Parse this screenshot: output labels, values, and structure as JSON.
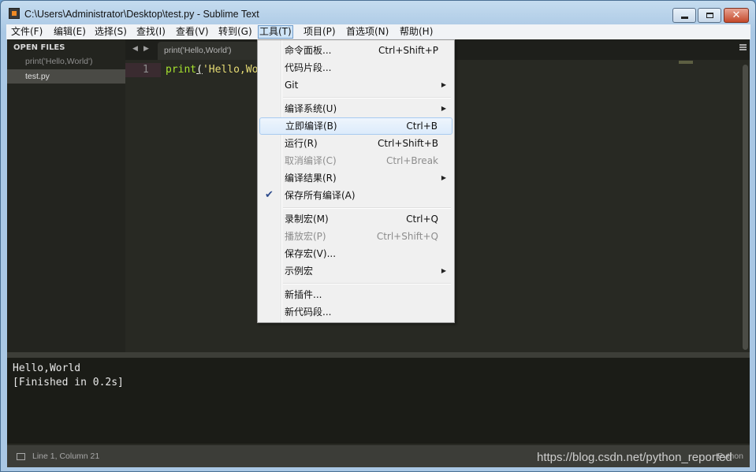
{
  "window": {
    "title": "C:\\Users\\Administrator\\Desktop\\test.py - Sublime Text",
    "icon": "sublime-text-icon",
    "controls": {
      "minimize": "_",
      "maximize": "□",
      "close": "✕"
    }
  },
  "menubar": {
    "items": [
      {
        "label": "文件(F)"
      },
      {
        "label": "编辑(E)"
      },
      {
        "label": "选择(S)"
      },
      {
        "label": "查找(I)"
      },
      {
        "label": "查看(V)"
      },
      {
        "label": "转到(G)"
      },
      {
        "label": "工具(T)",
        "active": true
      },
      {
        "label": "项目(P)"
      },
      {
        "label": "首选项(N)"
      },
      {
        "label": "帮助(H)"
      }
    ]
  },
  "sidebar": {
    "header": "OPEN FILES",
    "files": [
      {
        "label": "print('Hello,World')",
        "selected": false
      },
      {
        "label": "test.py",
        "selected": true
      }
    ]
  },
  "tabs": {
    "prev": "◀",
    "next": "▶",
    "items": [
      {
        "label": "print('Hello,World')"
      }
    ]
  },
  "editor": {
    "line_number": "1",
    "code": {
      "fn": "print",
      "open": "(",
      "str": "'Hello,Wo"
    }
  },
  "output": {
    "lines": [
      "Hello,World",
      "[Finished in 0.2s]"
    ]
  },
  "statusbar": {
    "position": "Line 1, Column 21",
    "syntax": "Python"
  },
  "watermark": "https://blog.csdn.net/python_reported",
  "tools_menu": {
    "check": "✔",
    "submenu_arrow": "▶",
    "items": [
      {
        "label": "命令面板...",
        "shortcut": "Ctrl+Shift+P"
      },
      {
        "label": "代码片段..."
      },
      {
        "label": "Git",
        "submenu": true
      },
      {
        "label": "编译系统(U)",
        "submenu": true
      },
      {
        "label": "立即编译(B)",
        "shortcut": "Ctrl+B",
        "highlighted": true
      },
      {
        "label": "运行(R)",
        "shortcut": "Ctrl+Shift+B"
      },
      {
        "label": "取消编译(C)",
        "shortcut": "Ctrl+Break",
        "disabled": true
      },
      {
        "label": "编译结果(R)",
        "submenu": true
      },
      {
        "label": "保存所有编译(A)",
        "checked": true
      },
      {
        "label": "录制宏(M)",
        "shortcut": "Ctrl+Q"
      },
      {
        "label": "播放宏(P)",
        "shortcut": "Ctrl+Shift+Q",
        "disabled": true
      },
      {
        "label": "保存宏(V)..."
      },
      {
        "label": "示例宏",
        "submenu": true
      },
      {
        "label": "新插件..."
      },
      {
        "label": "新代码段..."
      }
    ]
  }
}
